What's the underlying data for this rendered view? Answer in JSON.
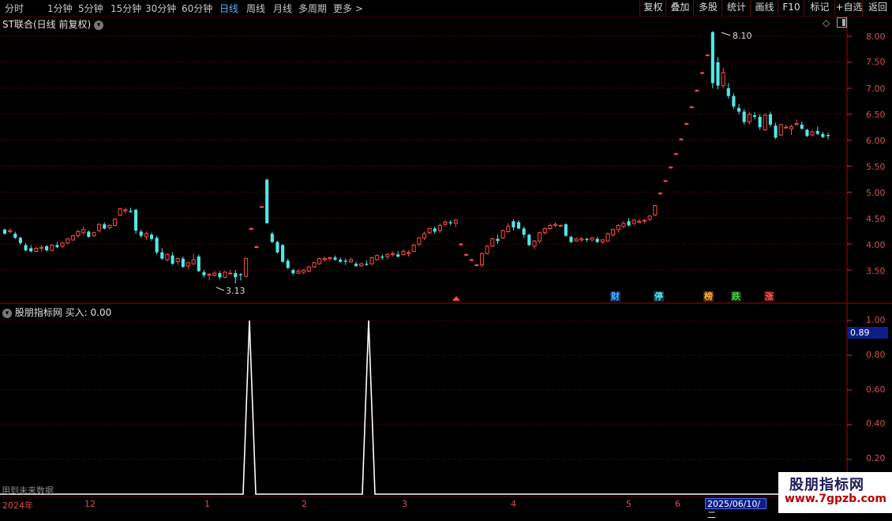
{
  "toolbar": {
    "periods": [
      "分时",
      "1分钟",
      "5分钟",
      "15分钟",
      "30分钟",
      "60分钟",
      "日线",
      "周线",
      "月线",
      "多周期",
      "更多 >"
    ],
    "active_period": "日线",
    "right_buttons": [
      "复权",
      "叠加",
      "多股",
      "统计",
      "画线",
      "F10",
      "标记",
      "+自选",
      "返回"
    ]
  },
  "main_panel": {
    "title": "ST联合(日线 前复权)",
    "y_ticks": [
      "8.00",
      "7.50",
      "7.00",
      "6.50",
      "6.00",
      "5.50",
      "5.00",
      "4.50",
      "4.00",
      "3.50"
    ],
    "high_label": "8.10",
    "low_label": "3.13",
    "events": [
      "财",
      "停",
      "榜",
      "跌",
      "涨"
    ]
  },
  "indicator_panel": {
    "title": "股朋指标网 买入: 0.00",
    "y_ticks": [
      "1.00",
      "0.80",
      "0.60",
      "0.40",
      "0.20"
    ],
    "current_value": "0.89",
    "future_note": "用到未来数据"
  },
  "date_axis": {
    "labels": [
      "2024年",
      "12",
      "1",
      "2",
      "3",
      "4",
      "5",
      "6"
    ],
    "cursor": "2025/06/10/二"
  },
  "watermark": {
    "title": "股朋指标网",
    "url": "www.7gpzb.com"
  },
  "colors": {
    "up": "#ff4a4a",
    "down": "#52e8e8",
    "grid": "#7a1010",
    "signal": "#ffffff",
    "active": "#4fb4ff"
  },
  "chart_data": [
    {
      "type": "candlestick",
      "y_range": [
        3.1,
        8.2
      ],
      "note": "daily OHLC, approximate",
      "ohlc": [
        [
          4.28,
          4.3,
          4.18,
          4.2
        ],
        [
          4.24,
          4.3,
          4.2,
          4.26
        ],
        [
          4.2,
          4.24,
          4.1,
          4.12
        ],
        [
          4.12,
          4.14,
          3.98,
          4.02
        ],
        [
          3.98,
          4.02,
          3.86,
          3.88
        ],
        [
          3.92,
          3.98,
          3.84,
          3.86
        ],
        [
          3.86,
          3.94,
          3.84,
          3.92
        ],
        [
          3.92,
          3.98,
          3.86,
          3.94
        ],
        [
          3.96,
          3.98,
          3.86,
          3.88
        ],
        [
          3.88,
          4.0,
          3.86,
          3.98
        ],
        [
          3.98,
          4.04,
          3.92,
          3.94
        ],
        [
          3.96,
          4.04,
          3.92,
          4.02
        ],
        [
          4.02,
          4.12,
          4.0,
          4.1
        ],
        [
          4.08,
          4.18,
          4.06,
          4.16
        ],
        [
          4.16,
          4.28,
          4.12,
          4.24
        ],
        [
          4.22,
          4.34,
          4.18,
          4.28
        ],
        [
          4.24,
          4.26,
          4.12,
          4.14
        ],
        [
          4.16,
          4.24,
          4.14,
          4.22
        ],
        [
          4.26,
          4.4,
          4.22,
          4.38
        ],
        [
          4.38,
          4.42,
          4.28,
          4.3
        ],
        [
          4.32,
          4.38,
          4.28,
          4.36
        ],
        [
          4.36,
          4.5,
          4.34,
          4.48
        ],
        [
          4.56,
          4.7,
          4.54,
          4.68
        ],
        [
          4.64,
          4.7,
          4.58,
          4.66
        ],
        [
          4.64,
          4.7,
          4.6,
          4.62
        ],
        [
          4.66,
          4.68,
          4.2,
          4.26
        ],
        [
          4.24,
          4.28,
          4.12,
          4.16
        ],
        [
          4.14,
          4.24,
          4.08,
          4.2
        ],
        [
          4.18,
          4.22,
          4.06,
          4.1
        ],
        [
          4.12,
          4.16,
          3.8,
          3.84
        ],
        [
          3.84,
          3.92,
          3.7,
          3.72
        ],
        [
          3.7,
          3.82,
          3.66,
          3.8
        ],
        [
          3.78,
          3.84,
          3.6,
          3.62
        ],
        [
          3.66,
          3.74,
          3.6,
          3.72
        ],
        [
          3.72,
          3.76,
          3.54,
          3.56
        ],
        [
          3.58,
          3.66,
          3.52,
          3.64
        ],
        [
          3.62,
          3.82,
          3.6,
          3.7
        ],
        [
          3.76,
          3.8,
          3.46,
          3.48
        ],
        [
          3.46,
          3.5,
          3.36,
          3.4
        ],
        [
          3.4,
          3.44,
          3.3,
          3.42
        ],
        [
          3.4,
          3.48,
          3.38,
          3.44
        ],
        [
          3.44,
          3.48,
          3.32,
          3.36
        ],
        [
          3.36,
          3.48,
          3.34,
          3.46
        ],
        [
          3.44,
          3.5,
          3.42,
          3.44
        ],
        [
          3.44,
          3.5,
          3.24,
          3.36
        ],
        [
          3.42,
          3.44,
          3.3,
          3.4
        ],
        [
          3.38,
          3.74,
          3.36,
          3.72
        ],
        [
          4.3,
          4.32,
          4.28,
          4.3
        ],
        [
          3.95,
          3.97,
          3.93,
          3.95
        ],
        [
          4.72,
          4.74,
          4.7,
          4.72
        ],
        [
          5.24,
          5.26,
          4.4,
          4.4
        ],
        [
          4.2,
          4.24,
          4.02,
          4.04
        ],
        [
          4.04,
          4.06,
          3.82,
          3.84
        ],
        [
          3.98,
          4.0,
          3.64,
          3.66
        ],
        [
          3.68,
          3.72,
          3.52,
          3.54
        ],
        [
          3.5,
          3.52,
          3.4,
          3.44
        ],
        [
          3.44,
          3.52,
          3.42,
          3.48
        ],
        [
          3.46,
          3.52,
          3.42,
          3.5
        ],
        [
          3.48,
          3.58,
          3.46,
          3.56
        ],
        [
          3.56,
          3.66,
          3.54,
          3.64
        ],
        [
          3.62,
          3.74,
          3.6,
          3.72
        ],
        [
          3.7,
          3.76,
          3.66,
          3.72
        ],
        [
          3.72,
          3.76,
          3.68,
          3.74
        ],
        [
          3.74,
          3.78,
          3.68,
          3.7
        ],
        [
          3.7,
          3.74,
          3.64,
          3.66
        ],
        [
          3.68,
          3.72,
          3.6,
          3.66
        ],
        [
          3.66,
          3.74,
          3.64,
          3.7
        ],
        [
          3.62,
          3.66,
          3.56,
          3.58
        ],
        [
          3.58,
          3.64,
          3.56,
          3.62
        ],
        [
          3.62,
          3.68,
          3.58,
          3.6
        ],
        [
          3.62,
          3.76,
          3.6,
          3.74
        ],
        [
          3.7,
          3.8,
          3.68,
          3.78
        ],
        [
          3.76,
          3.8,
          3.7,
          3.74
        ],
        [
          3.76,
          3.82,
          3.7,
          3.8
        ],
        [
          3.8,
          3.86,
          3.76,
          3.82
        ],
        [
          3.8,
          3.86,
          3.74,
          3.76
        ],
        [
          3.8,
          3.9,
          3.78,
          3.86
        ],
        [
          3.82,
          3.88,
          3.76,
          3.84
        ],
        [
          3.86,
          4.0,
          3.84,
          3.98
        ],
        [
          4.0,
          4.14,
          3.96,
          4.12
        ],
        [
          4.12,
          4.24,
          4.08,
          4.2
        ],
        [
          4.22,
          4.32,
          4.18,
          4.3
        ],
        [
          4.3,
          4.34,
          4.2,
          4.24
        ],
        [
          4.26,
          4.4,
          4.22,
          4.36
        ],
        [
          4.38,
          4.46,
          4.34,
          4.42
        ],
        [
          4.42,
          4.46,
          4.36,
          4.4
        ],
        [
          4.4,
          4.48,
          4.32,
          4.46
        ],
        [
          4.0,
          4.02,
          3.98,
          4.0
        ],
        [
          3.8,
          3.82,
          3.78,
          3.8
        ],
        [
          3.7,
          3.72,
          3.68,
          3.7
        ],
        [
          3.6,
          3.62,
          3.58,
          3.6
        ],
        [
          3.6,
          3.84,
          3.56,
          3.82
        ],
        [
          3.82,
          3.98,
          3.8,
          3.96
        ],
        [
          3.96,
          4.12,
          3.94,
          4.1
        ],
        [
          4.1,
          4.18,
          4.0,
          4.06
        ],
        [
          4.12,
          4.28,
          4.1,
          4.26
        ],
        [
          4.24,
          4.4,
          4.22,
          4.34
        ],
        [
          4.44,
          4.48,
          4.26,
          4.32
        ],
        [
          4.42,
          4.46,
          4.28,
          4.3
        ],
        [
          4.3,
          4.34,
          4.12,
          4.18
        ],
        [
          4.18,
          4.2,
          3.96,
          3.98
        ],
        [
          3.96,
          4.08,
          3.9,
          4.06
        ],
        [
          4.06,
          4.24,
          4.02,
          4.22
        ],
        [
          4.22,
          4.32,
          4.18,
          4.3
        ],
        [
          4.3,
          4.4,
          4.28,
          4.36
        ],
        [
          4.36,
          4.42,
          4.32,
          4.38
        ],
        [
          4.36,
          4.38,
          4.34,
          4.36
        ],
        [
          4.38,
          4.4,
          4.14,
          4.16
        ],
        [
          4.14,
          4.16,
          4.02,
          4.04
        ],
        [
          4.06,
          4.12,
          4.04,
          4.1
        ],
        [
          4.08,
          4.14,
          4.04,
          4.1
        ],
        [
          4.1,
          4.12,
          4.04,
          4.08
        ],
        [
          4.08,
          4.14,
          4.06,
          4.12
        ],
        [
          4.1,
          4.14,
          4.02,
          4.04
        ],
        [
          4.04,
          4.1,
          4.0,
          4.08
        ],
        [
          4.06,
          4.22,
          4.04,
          4.2
        ],
        [
          4.18,
          4.3,
          4.14,
          4.28
        ],
        [
          4.28,
          4.38,
          4.22,
          4.36
        ],
        [
          4.34,
          4.44,
          4.3,
          4.4
        ],
        [
          4.44,
          4.5,
          4.34,
          4.36
        ],
        [
          4.4,
          4.48,
          4.36,
          4.46
        ],
        [
          4.42,
          4.48,
          4.4,
          4.44
        ],
        [
          4.44,
          4.48,
          4.4,
          4.46
        ],
        [
          4.48,
          4.56,
          4.44,
          4.54
        ],
        [
          4.56,
          4.76,
          4.54,
          4.74
        ],
        [
          4.98,
          5.0,
          4.96,
          4.98
        ],
        [
          5.22,
          5.24,
          5.2,
          5.22
        ],
        [
          5.48,
          5.5,
          5.46,
          5.48
        ],
        [
          5.74,
          5.76,
          5.72,
          5.74
        ],
        [
          6.02,
          6.04,
          6.0,
          6.02
        ],
        [
          6.32,
          6.34,
          6.3,
          6.32
        ],
        [
          6.64,
          6.66,
          6.62,
          6.64
        ],
        [
          6.96,
          6.98,
          6.94,
          6.96
        ],
        [
          7.3,
          7.32,
          7.28,
          7.3
        ],
        [
          7.64,
          7.66,
          7.62,
          7.64
        ],
        [
          8.08,
          8.1,
          7.0,
          7.1
        ],
        [
          7.5,
          7.6,
          6.98,
          7.05
        ],
        [
          7.05,
          7.4,
          7.0,
          7.3
        ],
        [
          7.0,
          7.1,
          6.8,
          6.85
        ],
        [
          6.85,
          6.9,
          6.6,
          6.65
        ],
        [
          6.62,
          6.7,
          6.5,
          6.55
        ],
        [
          6.55,
          6.6,
          6.3,
          6.35
        ],
        [
          6.35,
          6.55,
          6.3,
          6.5
        ],
        [
          6.48,
          6.54,
          6.4,
          6.45
        ],
        [
          6.45,
          6.5,
          6.2,
          6.25
        ],
        [
          6.2,
          6.52,
          6.18,
          6.48
        ],
        [
          6.5,
          6.55,
          6.26,
          6.3
        ],
        [
          6.28,
          6.34,
          6.02,
          6.05
        ],
        [
          6.1,
          6.32,
          6.08,
          6.3
        ],
        [
          6.25,
          6.3,
          6.24,
          6.25
        ],
        [
          6.22,
          6.3,
          6.1,
          6.26
        ],
        [
          6.3,
          6.4,
          6.28,
          6.32
        ],
        [
          6.3,
          6.36,
          6.2,
          6.22
        ],
        [
          6.2,
          6.22,
          6.06,
          6.08
        ],
        [
          6.1,
          6.2,
          6.08,
          6.16
        ],
        [
          6.18,
          6.26,
          6.1,
          6.12
        ],
        [
          6.12,
          6.16,
          6.04,
          6.06
        ],
        [
          6.1,
          6.14,
          6.02,
          6.08
        ]
      ]
    },
    {
      "type": "line",
      "series": [
        {
          "name": "买入",
          "values_note": "0 everywhere except two spikes to 1.00",
          "spikes": [
            1.0,
            1.0
          ]
        }
      ],
      "y_range": [
        0,
        1.0
      ]
    }
  ]
}
